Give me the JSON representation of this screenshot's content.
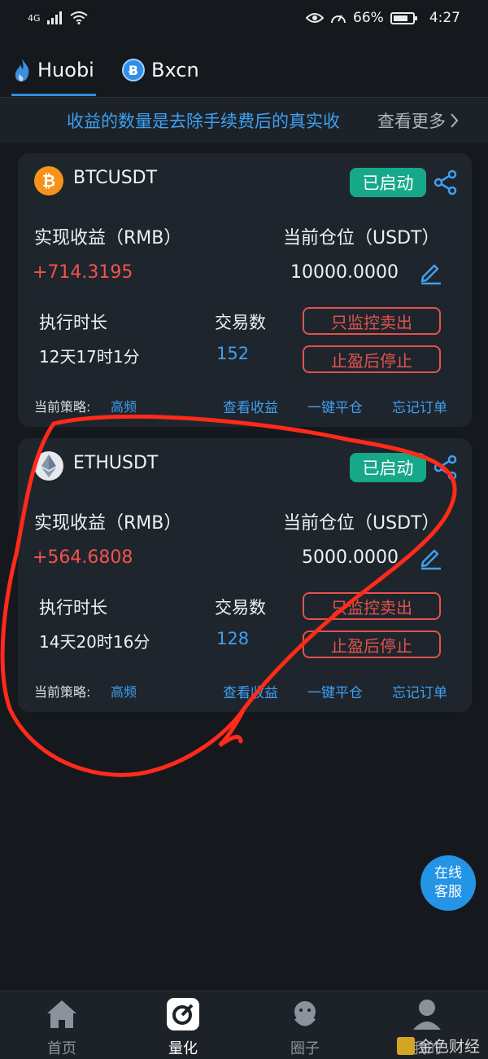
{
  "status_bar": {
    "network": "4G",
    "battery_percent": "66%",
    "time": "4:27"
  },
  "tabs": [
    {
      "label": "Huobi",
      "active": true
    },
    {
      "label": "Bxcn",
      "active": false
    }
  ],
  "notice": {
    "text": "收益的数量是去除手续费后的真实收",
    "more": "查看更多"
  },
  "cards": [
    {
      "pair": "BTCUSDT",
      "status": "已启动",
      "profit_label": "实现收益（RMB）",
      "position_label": "当前仓位（USDT）",
      "profit": "+714.3195",
      "position": "10000.0000",
      "duration_label": "执行时长",
      "duration": "12天17时1分",
      "trades_label": "交易数",
      "trades": "152",
      "btn_sell_only": "只监控卖出",
      "btn_stop_after": "止盈后停止",
      "strategy_label": "当前策略:",
      "strategy": "高频",
      "link_view_profit": "查看收益",
      "link_close": "一键平仓",
      "link_forget": "忘记订单"
    },
    {
      "pair": "ETHUSDT",
      "status": "已启动",
      "profit_label": "实现收益（RMB）",
      "position_label": "当前仓位（USDT）",
      "profit": "+564.6808",
      "position": "5000.0000",
      "duration_label": "执行时长",
      "duration": "14天20时16分",
      "trades_label": "交易数",
      "trades": "128",
      "btn_sell_only": "只监控卖出",
      "btn_stop_after": "止盈后停止",
      "strategy_label": "当前策略:",
      "strategy": "高频",
      "link_view_profit": "查看收益",
      "link_close": "一键平仓",
      "link_forget": "忘记订单"
    }
  ],
  "service_button": {
    "line1": "在线",
    "line2": "客服"
  },
  "bottom_nav": [
    {
      "label": "首页",
      "icon": "home-icon"
    },
    {
      "label": "量化",
      "icon": "quant-icon",
      "active": true
    },
    {
      "label": "圈子",
      "icon": "community-icon"
    },
    {
      "label": "我的",
      "icon": "profile-icon"
    }
  ],
  "watermark": "金色财经",
  "colors": {
    "accent": "#3ea0f2",
    "profit": "#f0534f",
    "badge": "#17a88a",
    "annotation": "#ff2a1a"
  }
}
